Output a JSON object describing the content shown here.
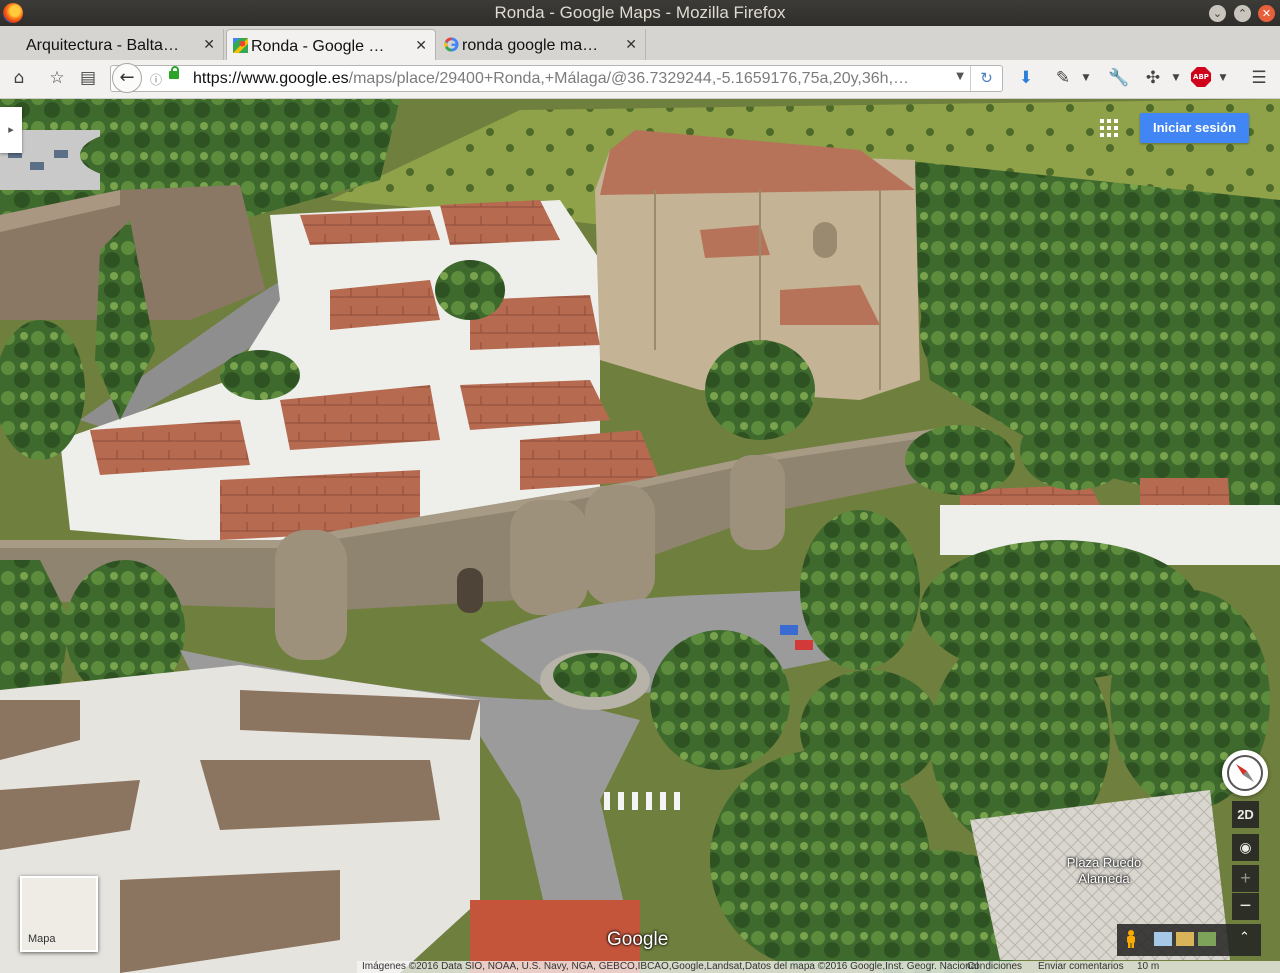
{
  "window": {
    "title": "Ronda - Google Maps - Mozilla Firefox"
  },
  "tabs": [
    {
      "label": "Arquitectura - Balta…",
      "favicon": "page-icon",
      "active": false
    },
    {
      "label": "Ronda - Google …",
      "favicon": "google-maps-icon",
      "active": true
    },
    {
      "label": "ronda google ma…",
      "favicon": "google-g-icon",
      "active": false
    }
  ],
  "navbar": {
    "url_domain": "https://www.google.es",
    "url_path": "/maps/place/29400+Ronda,+Málaga/@36.7329244,-5.1659176,75a,20y,36h,…"
  },
  "map": {
    "signin_label": "Iniciar sesión",
    "btn_2d_label": "2D",
    "zoom_in_label": "+",
    "zoom_out_label": "−",
    "place_label_line1": "Plaza Ruedo",
    "place_label_line2": "Alameda",
    "minimap_label": "Mapa",
    "google_logo": "Google",
    "view": "3D satellite"
  },
  "footer": {
    "attribution": "Imágenes ©2016 Data SIO, NOAA, U.S. Navy, NGA, GEBCO,IBCAO,Google,Landsat,Datos del mapa ©2016 Google,Inst. Geogr. Nacional",
    "terms": "Condiciones",
    "feedback": "Enviar comentarios",
    "scale": "10 m"
  },
  "colors": {
    "accent": "#4285f4",
    "abp": "#d0021b"
  }
}
